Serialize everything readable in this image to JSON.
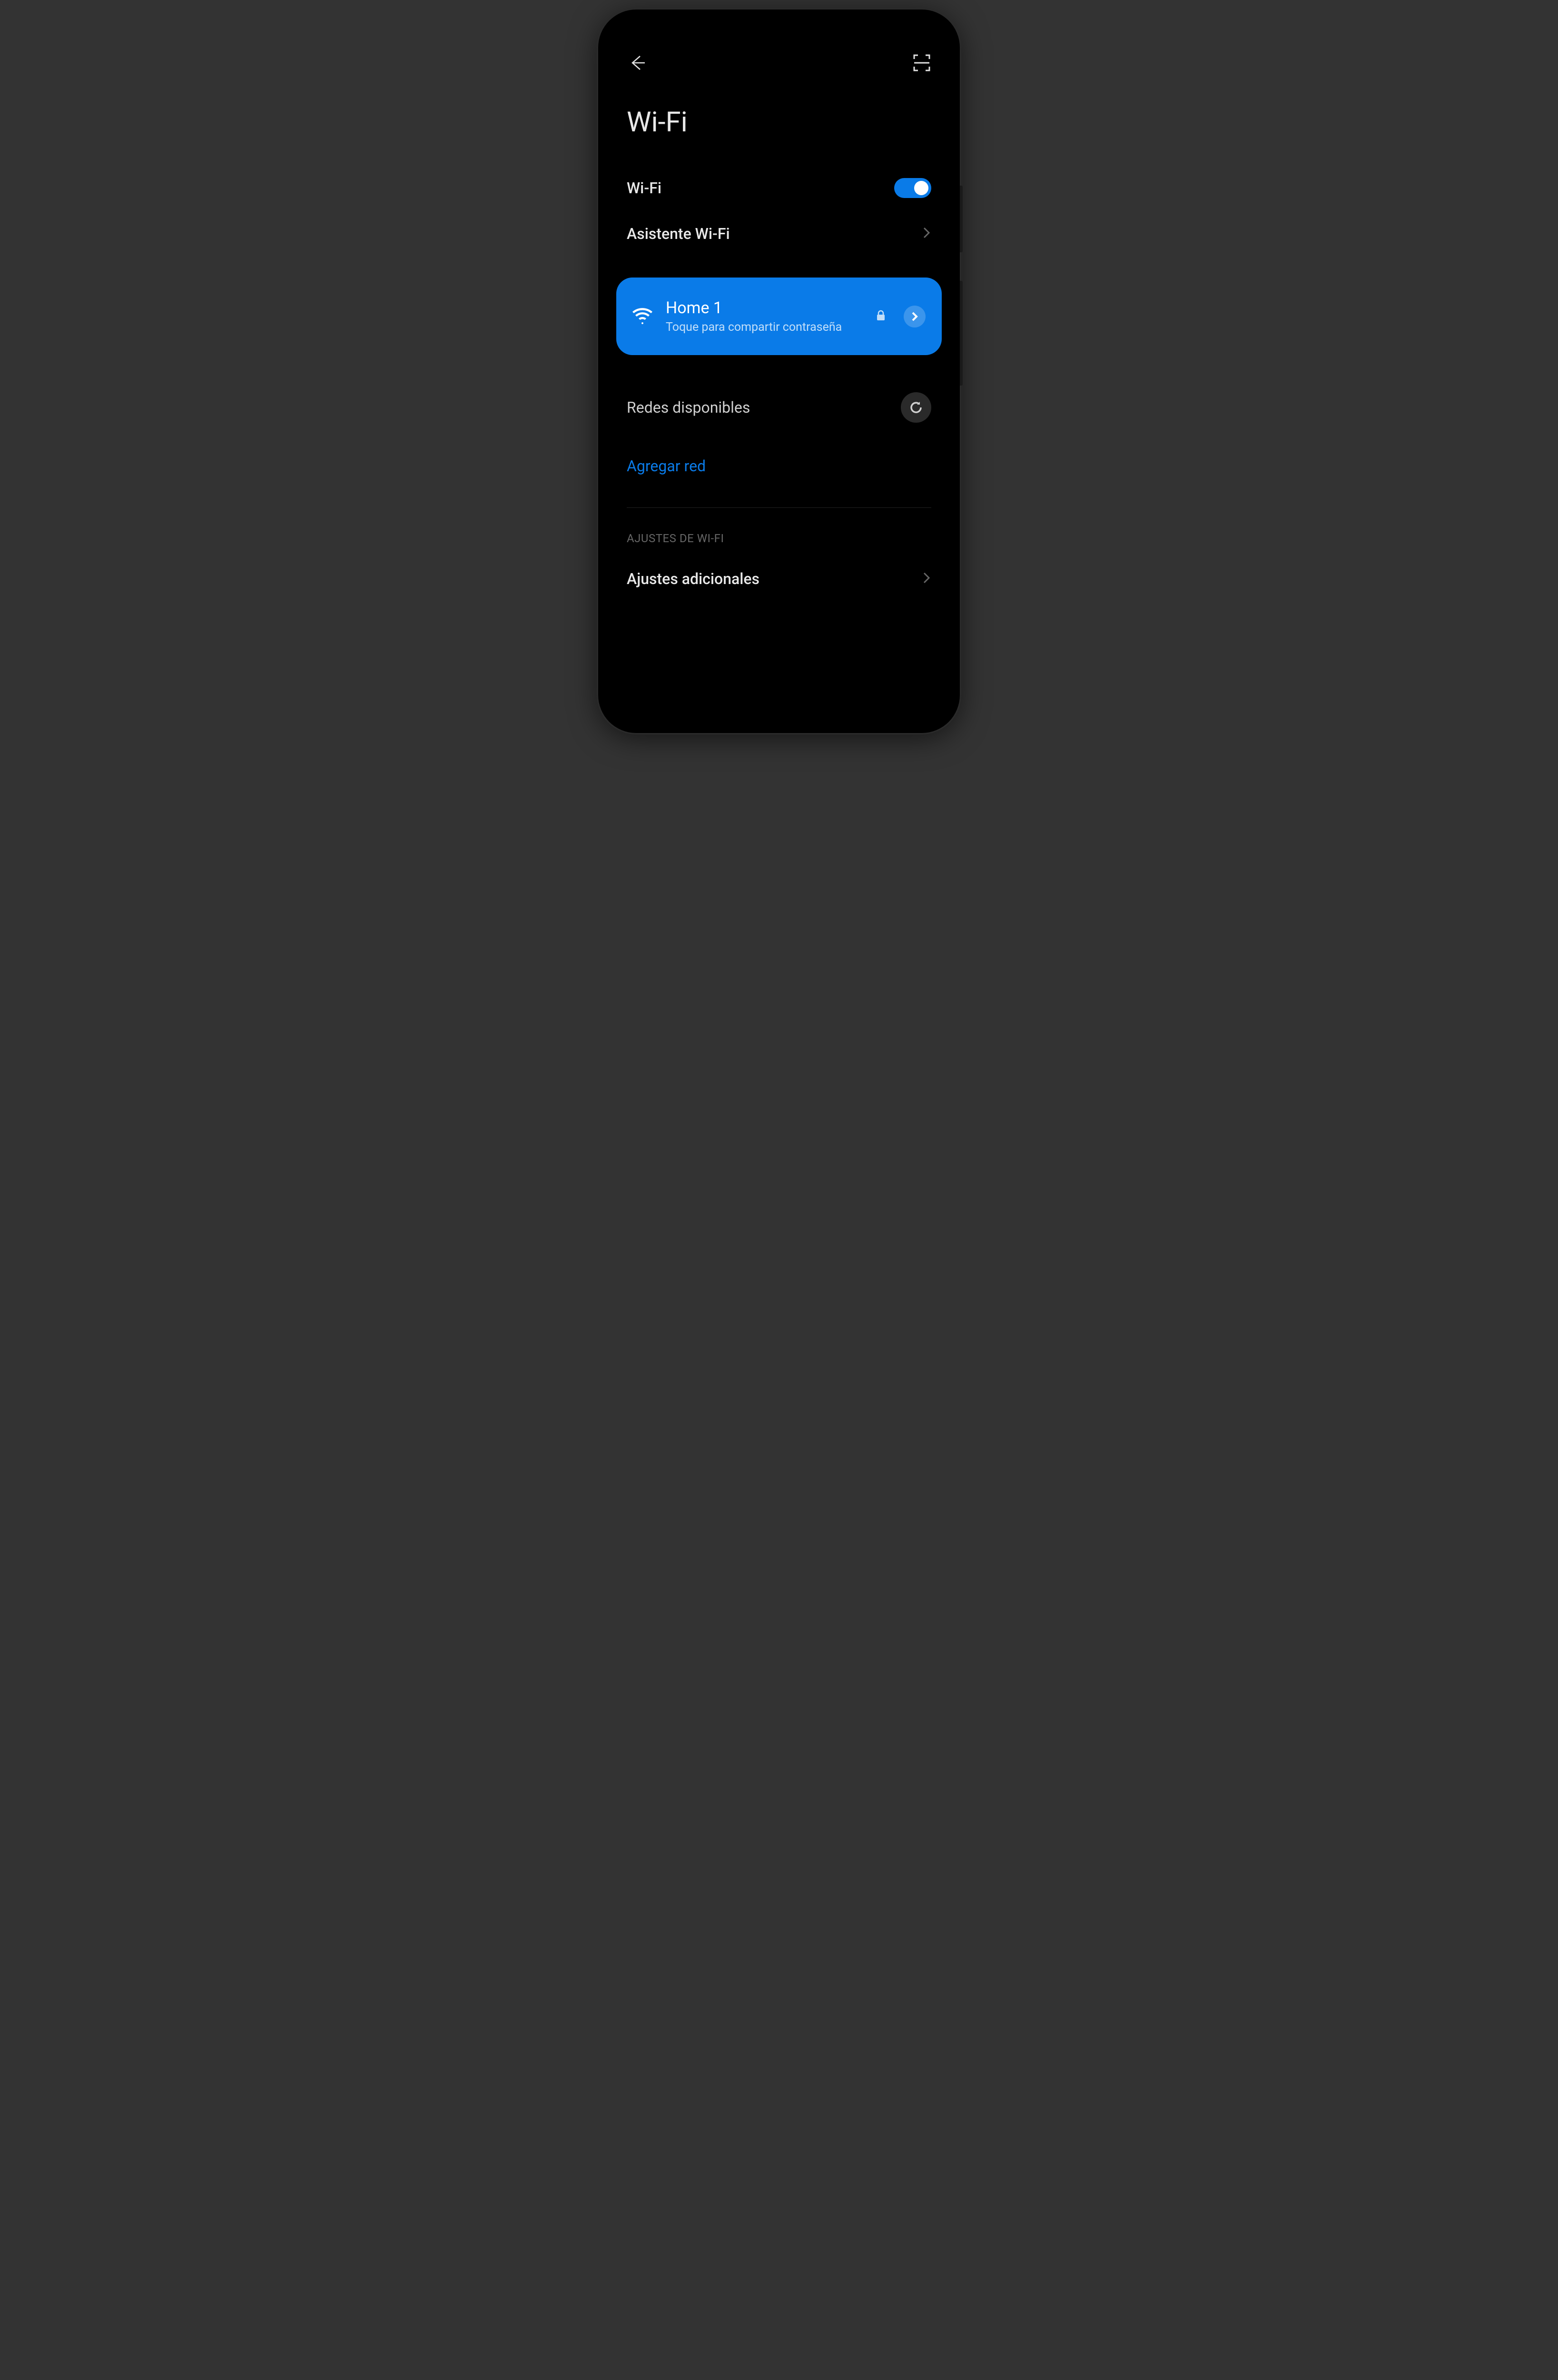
{
  "page_title": "Wi-Fi",
  "wifi_toggle": {
    "label": "Wi-Fi",
    "on": true
  },
  "assistant_row": {
    "label": "Asistente Wi-Fi"
  },
  "connected": {
    "name": "Home 1",
    "hint": "Toque para compartir contraseña"
  },
  "available": {
    "title": "Redes disponibles"
  },
  "add_network_label": "Agregar red",
  "settings_section": {
    "header": "AJUSTES DE WI-FI",
    "additional_label": "Ajustes adicionales"
  }
}
